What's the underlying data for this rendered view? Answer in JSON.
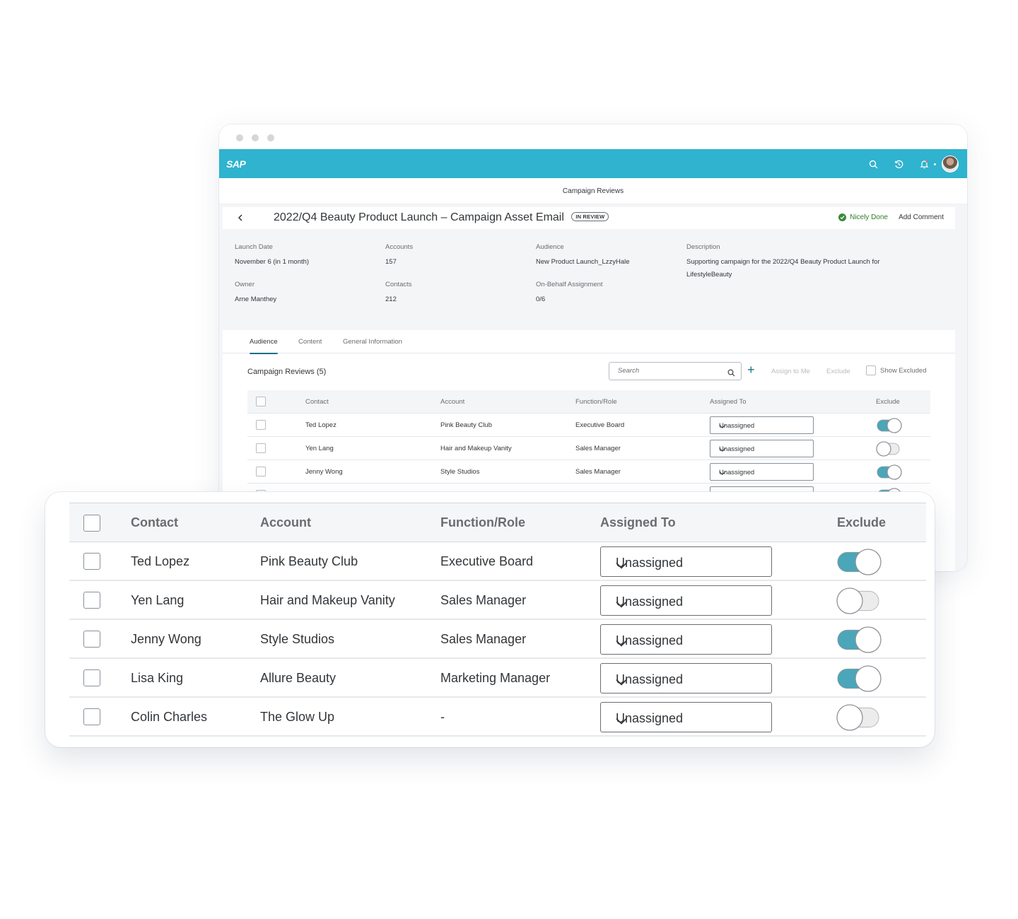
{
  "window": {
    "brand": "SAP",
    "shell_icons": [
      "search-icon",
      "history-icon",
      "notification-bell-icon",
      "user-avatar"
    ],
    "page_subtitle": "Campaign Reviews",
    "object": {
      "title": "2022/Q4 Beauty Product Launch – Campaign Asset Email",
      "status_badge": "IN REVIEW",
      "approve_action": "Nicely Done",
      "comment_action": "Add Comment"
    },
    "attributes": [
      {
        "label": "Launch Date",
        "value": "November 6 (in 1 month)"
      },
      {
        "label": "Accounts",
        "value": "157"
      },
      {
        "label": "Audience",
        "value": "New Product Launch_LzzyHale"
      },
      {
        "label": "Description",
        "value": "Supporting campaign for the 2022/Q4 Beauty Product Launch for LifestyleBeauty"
      },
      {
        "label": "Owner",
        "value": "Arne Manthey"
      },
      {
        "label": "Contacts",
        "value": "212"
      },
      {
        "label": "On-Behalf Assignment",
        "value": "0/6"
      }
    ],
    "tabs": [
      {
        "label": "Audience",
        "active": true
      },
      {
        "label": "Content",
        "active": false
      },
      {
        "label": "General Information",
        "active": false
      }
    ],
    "toolbar": {
      "table_title": "Campaign Reviews (5)",
      "search_placeholder": "Search",
      "assign_to_me": "Assign to Me",
      "exclude": "Exclude",
      "show_excluded": "Show Excluded"
    }
  },
  "table": {
    "columns": [
      "Contact",
      "Account",
      "Function/Role",
      "Assigned To",
      "Exclude"
    ],
    "rows": [
      {
        "contact": "Ted Lopez",
        "account": "Pink Beauty Club",
        "role": "Executive Board",
        "assigned_to": "Unassigned",
        "excluded": true
      },
      {
        "contact": "Yen Lang",
        "account": "Hair and Makeup Vanity",
        "role": "Sales Manager",
        "assigned_to": "Unassigned",
        "excluded": false
      },
      {
        "contact": "Jenny Wong",
        "account": "Style Studios",
        "role": "Sales Manager",
        "assigned_to": "Unassigned",
        "excluded": true
      },
      {
        "contact": "Lisa King",
        "account": "Allure Beauty",
        "role": "Marketing Manager",
        "assigned_to": "Unassigned",
        "excluded": true
      },
      {
        "contact": "Colin Charles",
        "account": "The Glow Up",
        "role": "-",
        "assigned_to": "Unassigned",
        "excluded": false
      }
    ]
  },
  "colors": {
    "shell": "#2fb3ce",
    "toggle_on": "#4aa6b8",
    "success": "#2b7d2b",
    "text": "#32363a",
    "muted": "#6a6d70"
  }
}
